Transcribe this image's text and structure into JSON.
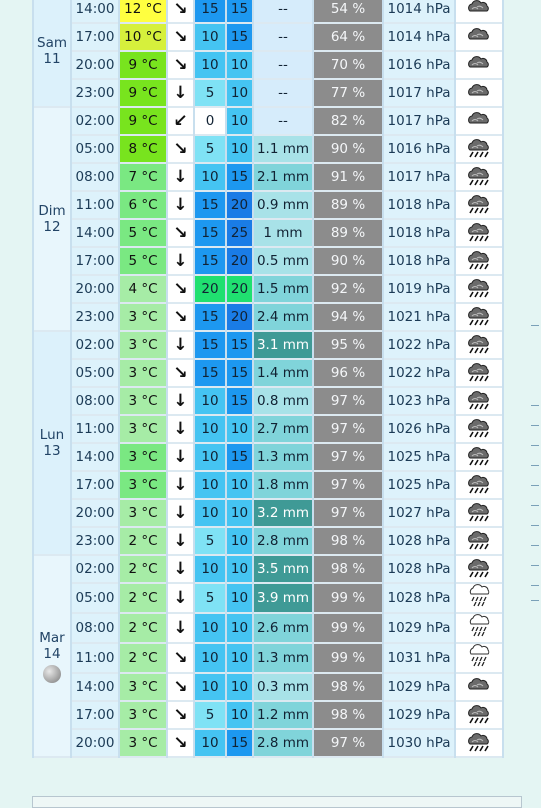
{
  "days": [
    {
      "name": "Sam",
      "num": "11",
      "moon": false,
      "rows": [
        {
          "hour": "14:00",
          "temp": "12 °C",
          "tc": "#ffff40",
          "arrow": "↘",
          "s1": "15",
          "s2": "15",
          "c1": "#1d98f0",
          "c2": "#1d98f0",
          "rain": "--",
          "rc": "#d6ecfb",
          "rw": false,
          "hum": "54 %",
          "pres": "1014 hPa",
          "icon": "cloud-icon"
        },
        {
          "hour": "17:00",
          "temp": "10 °C",
          "tc": "#d6f03c",
          "arrow": "↘",
          "s1": "10",
          "s2": "15",
          "c1": "#45c4f2",
          "c2": "#1d98f0",
          "rain": "--",
          "rc": "#d6ecfb",
          "rw": false,
          "hum": "64 %",
          "pres": "1014 hPa",
          "icon": "cloud-icon"
        },
        {
          "hour": "20:00",
          "temp": "9 °C",
          "tc": "#78e41e",
          "arrow": "↘",
          "s1": "10",
          "s2": "10",
          "c1": "#45c4f2",
          "c2": "#45c4f2",
          "rain": "--",
          "rc": "#d6ecfb",
          "rw": false,
          "hum": "70 %",
          "pres": "1016 hPa",
          "icon": "cloud-icon"
        },
        {
          "hour": "23:00",
          "temp": "9 °C",
          "tc": "#78e41e",
          "arrow": "↓",
          "s1": "5",
          "s2": "10",
          "c1": "#7fe2f5",
          "c2": "#45c4f2",
          "rain": "--",
          "rc": "#d6ecfb",
          "rw": false,
          "hum": "77 %",
          "pres": "1017 hPa",
          "icon": "cloud-icon"
        }
      ]
    },
    {
      "name": "Dim",
      "num": "12",
      "moon": false,
      "rows": [
        {
          "hour": "02:00",
          "temp": "9 °C",
          "tc": "#78e41e",
          "arrow": "↙",
          "s1": "0",
          "s2": "10",
          "c1": "#ffffff",
          "c2": "#45c4f2",
          "rain": "--",
          "rc": "#d6ecfb",
          "rw": false,
          "hum": "82 %",
          "pres": "1017 hPa",
          "icon": "cloud-icon"
        },
        {
          "hour": "05:00",
          "temp": "8 °C",
          "tc": "#78e41e",
          "arrow": "↘",
          "s1": "5",
          "s2": "10",
          "c1": "#7fe2f5",
          "c2": "#45c4f2",
          "rain": "1.1 mm",
          "rc": "#a8e2e8",
          "rw": false,
          "hum": "90 %",
          "pres": "1016 hPa",
          "icon": "rain-cloud-icon"
        },
        {
          "hour": "08:00",
          "temp": "7 °C",
          "tc": "#7ae882",
          "arrow": "↓",
          "s1": "10",
          "s2": "15",
          "c1": "#45c4f2",
          "c2": "#1d98f0",
          "rain": "2.1 mm",
          "rc": "#80d4da",
          "rw": false,
          "hum": "91 %",
          "pres": "1017 hPa",
          "icon": "rain-cloud-icon"
        },
        {
          "hour": "11:00",
          "temp": "6 °C",
          "tc": "#7ae882",
          "arrow": "↓",
          "s1": "15",
          "s2": "20",
          "c1": "#1d98f0",
          "c2": "#1a7ce6",
          "rain": "0.9 mm",
          "rc": "#a8e2e8",
          "rw": false,
          "hum": "89 %",
          "pres": "1018 hPa",
          "icon": "rain-cloud-icon"
        },
        {
          "hour": "14:00",
          "temp": "5 °C",
          "tc": "#7ae882",
          "arrow": "↘",
          "s1": "15",
          "s2": "25",
          "c1": "#1d98f0",
          "c2": "#1a7ce6",
          "rain": "1 mm",
          "rc": "#a8e2e8",
          "rw": false,
          "hum": "89 %",
          "pres": "1018 hPa",
          "icon": "rain-cloud-icon"
        },
        {
          "hour": "17:00",
          "temp": "5 °C",
          "tc": "#7ae882",
          "arrow": "↓",
          "s1": "15",
          "s2": "20",
          "c1": "#1d98f0",
          "c2": "#1a7ce6",
          "rain": "0.5 mm",
          "rc": "#a8e2e8",
          "rw": false,
          "hum": "90 %",
          "pres": "1018 hPa",
          "icon": "rain-cloud-icon"
        },
        {
          "hour": "20:00",
          "temp": "4 °C",
          "tc": "#a6eca6",
          "arrow": "↘",
          "s1": "20",
          "s2": "20",
          "c1": "#20e070",
          "c2": "#20e070",
          "rain": "1.5 mm",
          "rc": "#80d4da",
          "rw": false,
          "hum": "92 %",
          "pres": "1019 hPa",
          "icon": "rain-cloud-icon"
        },
        {
          "hour": "23:00",
          "temp": "3 °C",
          "tc": "#a6eca6",
          "arrow": "↘",
          "s1": "15",
          "s2": "20",
          "c1": "#1d98f0",
          "c2": "#1a7ce6",
          "rain": "2.4 mm",
          "rc": "#80d4da",
          "rw": false,
          "hum": "94 %",
          "pres": "1021 hPa",
          "icon": "rain-cloud-icon"
        }
      ]
    },
    {
      "name": "Lun",
      "num": "13",
      "moon": false,
      "rows": [
        {
          "hour": "02:00",
          "temp": "3 °C",
          "tc": "#a6eca6",
          "arrow": "↓",
          "s1": "15",
          "s2": "15",
          "c1": "#1d98f0",
          "c2": "#1d98f0",
          "rain": "3.1 mm",
          "rc": "#3f9a96",
          "rw": true,
          "hum": "95 %",
          "pres": "1022 hPa",
          "icon": "rain-cloud-icon"
        },
        {
          "hour": "05:00",
          "temp": "3 °C",
          "tc": "#a6eca6",
          "arrow": "↘",
          "s1": "15",
          "s2": "15",
          "c1": "#1d98f0",
          "c2": "#1d98f0",
          "rain": "1.4 mm",
          "rc": "#80d4da",
          "rw": false,
          "hum": "96 %",
          "pres": "1022 hPa",
          "icon": "rain-cloud-icon"
        },
        {
          "hour": "08:00",
          "temp": "3 °C",
          "tc": "#a6eca6",
          "arrow": "↓",
          "s1": "10",
          "s2": "15",
          "c1": "#45c4f2",
          "c2": "#1d98f0",
          "rain": "0.8 mm",
          "rc": "#a8e2e8",
          "rw": false,
          "hum": "97 %",
          "pres": "1023 hPa",
          "icon": "rain-cloud-icon"
        },
        {
          "hour": "11:00",
          "temp": "3 °C",
          "tc": "#a6eca6",
          "arrow": "↓",
          "s1": "10",
          "s2": "10",
          "c1": "#45c4f2",
          "c2": "#45c4f2",
          "rain": "2.7 mm",
          "rc": "#80d4da",
          "rw": false,
          "hum": "97 %",
          "pres": "1026 hPa",
          "icon": "rain-cloud-icon"
        },
        {
          "hour": "14:00",
          "temp": "3 °C",
          "tc": "#7ae882",
          "arrow": "↓",
          "s1": "10",
          "s2": "15",
          "c1": "#45c4f2",
          "c2": "#1d98f0",
          "rain": "1.3 mm",
          "rc": "#80d4da",
          "rw": false,
          "hum": "97 %",
          "pres": "1025 hPa",
          "icon": "rain-cloud-icon"
        },
        {
          "hour": "17:00",
          "temp": "3 °C",
          "tc": "#7ae882",
          "arrow": "↓",
          "s1": "10",
          "s2": "10",
          "c1": "#45c4f2",
          "c2": "#45c4f2",
          "rain": "1.8 mm",
          "rc": "#80d4da",
          "rw": false,
          "hum": "97 %",
          "pres": "1025 hPa",
          "icon": "rain-cloud-icon"
        },
        {
          "hour": "20:00",
          "temp": "3 °C",
          "tc": "#a6eca6",
          "arrow": "↓",
          "s1": "10",
          "s2": "10",
          "c1": "#45c4f2",
          "c2": "#45c4f2",
          "rain": "3.2 mm",
          "rc": "#3f9a96",
          "rw": true,
          "hum": "97 %",
          "pres": "1027 hPa",
          "icon": "rain-cloud-icon"
        },
        {
          "hour": "23:00",
          "temp": "2 °C",
          "tc": "#a6eca6",
          "arrow": "↓",
          "s1": "5",
          "s2": "10",
          "c1": "#7fe2f5",
          "c2": "#45c4f2",
          "rain": "2.8 mm",
          "rc": "#80d4da",
          "rw": false,
          "hum": "98 %",
          "pres": "1028 hPa",
          "icon": "rain-cloud-icon"
        }
      ]
    },
    {
      "name": "Mar",
      "num": "14",
      "moon": true,
      "rows": [
        {
          "hour": "02:00",
          "temp": "2 °C",
          "tc": "#a6eca6",
          "arrow": "↓",
          "s1": "10",
          "s2": "10",
          "c1": "#45c4f2",
          "c2": "#45c4f2",
          "rain": "3.5 mm",
          "rc": "#3f9a96",
          "rw": true,
          "hum": "98 %",
          "pres": "1028 hPa",
          "icon": "rain-cloud-icon"
        },
        {
          "hour": "05:00",
          "temp": "2 °C",
          "tc": "#a6eca6",
          "arrow": "↓",
          "s1": "5",
          "s2": "10",
          "c1": "#7fe2f5",
          "c2": "#45c4f2",
          "rain": "3.9 mm",
          "rc": "#3f9a96",
          "rw": true,
          "hum": "99 %",
          "pres": "1028 hPa",
          "icon": "heavy-rain-icon"
        },
        {
          "hour": "08:00",
          "temp": "2 °C",
          "tc": "#a6eca6",
          "arrow": "↓",
          "s1": "10",
          "s2": "10",
          "c1": "#45c4f2",
          "c2": "#45c4f2",
          "rain": "2.6 mm",
          "rc": "#80d4da",
          "rw": false,
          "hum": "99 %",
          "pres": "1029 hPa",
          "icon": "heavy-rain-icon"
        },
        {
          "hour": "11:00",
          "temp": "2 °C",
          "tc": "#a6eca6",
          "arrow": "↘",
          "s1": "10",
          "s2": "10",
          "c1": "#45c4f2",
          "c2": "#45c4f2",
          "rain": "1.3 mm",
          "rc": "#80d4da",
          "rw": false,
          "hum": "99 %",
          "pres": "1031 hPa",
          "icon": "heavy-rain-icon"
        },
        {
          "hour": "14:00",
          "temp": "3 °C",
          "tc": "#a6eca6",
          "arrow": "↘",
          "s1": "10",
          "s2": "10",
          "c1": "#45c4f2",
          "c2": "#45c4f2",
          "rain": "0.3 mm",
          "rc": "#a8e2e8",
          "rw": false,
          "hum": "98 %",
          "pres": "1029 hPa",
          "icon": "cloud-icon"
        },
        {
          "hour": "17:00",
          "temp": "3 °C",
          "tc": "#a6eca6",
          "arrow": "↘",
          "s1": "5",
          "s2": "10",
          "c1": "#7fe2f5",
          "c2": "#45c4f2",
          "rain": "1.2 mm",
          "rc": "#80d4da",
          "rw": false,
          "hum": "98 %",
          "pres": "1029 hPa",
          "icon": "rain-cloud-icon"
        },
        {
          "hour": "20:00",
          "temp": "3 °C",
          "tc": "#a6eca6",
          "arrow": "↘",
          "s1": "10",
          "s2": "15",
          "c1": "#45c4f2",
          "c2": "#1d98f0",
          "rain": "2.8 mm",
          "rc": "#80d4da",
          "rw": false,
          "hum": "97 %",
          "pres": "1030 hPa",
          "icon": "rain-cloud-icon"
        }
      ]
    }
  ]
}
